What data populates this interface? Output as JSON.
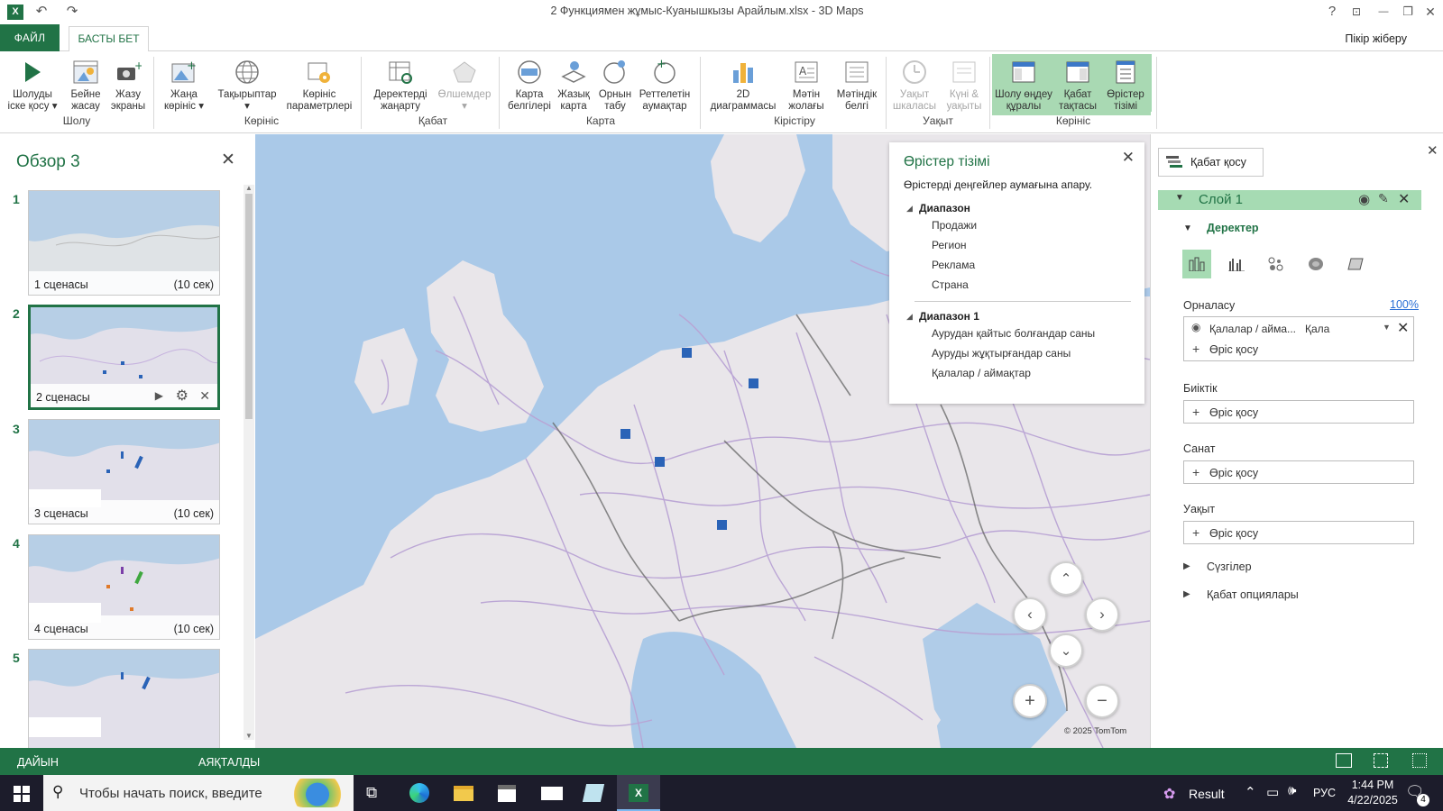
{
  "window": {
    "title": "2 Функциямен жұмыс-Куанышкызы Арайлым.xlsx - 3D Maps",
    "help": "?",
    "restore_icon": "restore-icon",
    "minimize": "—",
    "maximize": "❐",
    "close": "✕"
  },
  "tabs": {
    "file": "ФАЙЛ",
    "home": "БАСТЫ БЕТ",
    "feedback": "Пікір жіберу"
  },
  "ribbon": {
    "buttons": [
      {
        "label1": "Шолуды",
        "label2": "іске қосу ▾"
      },
      {
        "label1": "Бейне",
        "label2": "жасау"
      },
      {
        "label1": "Жазу",
        "label2": "экраны"
      },
      {
        "label1": "Жаңа",
        "label2": "көрініс ▾"
      },
      {
        "label1": "Тақырыптар",
        "label2": "▾"
      },
      {
        "label1": "Көрініс",
        "label2": "параметрлері"
      },
      {
        "label1": "Деректерді",
        "label2": "жаңарту"
      },
      {
        "label1": "Өлшемдер",
        "label2": "▾"
      },
      {
        "label1": "Карта",
        "label2": "белгілері"
      },
      {
        "label1": "Жазық",
        "label2": "карта"
      },
      {
        "label1": "Орнын",
        "label2": "табу"
      },
      {
        "label1": "Реттелетін",
        "label2": "аумақтар"
      },
      {
        "label1": "2D",
        "label2": "диаграммасы"
      },
      {
        "label1": "Мәтін",
        "label2": "жолағы"
      },
      {
        "label1": "Мәтіндік",
        "label2": "белгі"
      },
      {
        "label1": "Уақыт",
        "label2": "шкаласы"
      },
      {
        "label1": "Күні &",
        "label2": "уақыты"
      },
      {
        "label1": "Шолу өңдеу",
        "label2": "құралы"
      },
      {
        "label1": "Қабат",
        "label2": "тақтасы"
      },
      {
        "label1": "Өрістер",
        "label2": "тізімі"
      }
    ],
    "groups": [
      "Шолу",
      "Көрініс",
      "Қабат",
      "Карта",
      "Кірістіру",
      "Уақыт",
      "Көрініс"
    ]
  },
  "scenes": {
    "title": "Обзор 3",
    "close": "✕",
    "items": [
      {
        "num": "1",
        "caption": "1 сценасы",
        "duration": "(10 сек)"
      },
      {
        "num": "2",
        "caption": "2 сценасы",
        "duration": ""
      },
      {
        "num": "3",
        "caption": "3 сценасы",
        "duration": "(10 сек)"
      },
      {
        "num": "4",
        "caption": "4 сценасы",
        "duration": "(10 сек)"
      },
      {
        "num": "5",
        "caption": "",
        "duration": ""
      }
    ]
  },
  "field_list": {
    "title": "Өрістер тізімі",
    "subtitle": "Өрістерді деңгейлер аумағына апару.",
    "close": "✕",
    "groups": [
      {
        "name": "Диапазон",
        "items": [
          "Продажи",
          "Регион",
          "Реклама",
          "Страна"
        ]
      },
      {
        "name": "Диапазон 1",
        "items": [
          "Аурудан қайтыс болғандар саны",
          "Ауруды жұқтырғандар саны",
          "Қалалар / аймақтар"
        ]
      }
    ]
  },
  "map": {
    "copyright": "© 2025 TomTom"
  },
  "layer_panel": {
    "add_layer": "Қабат қосу",
    "close": "✕",
    "layer_name": "Слой 1",
    "data_header": "Деректер",
    "location_label": "Орналасу",
    "location_percent": "100%",
    "location_field": "Қалалар / айма...",
    "location_type": "Қала",
    "add_field": "Өріс қосу",
    "height_label": "Биіктік",
    "category_label": "Санат",
    "time_label": "Уақыт",
    "filters": "Сүзгілер",
    "layer_options": "Қабат опциялары"
  },
  "status": {
    "left": "ДАЙЫН",
    "middle": "АЯҚТАЛДЫ"
  },
  "taskbar": {
    "search_placeholder": "Чтобы начать поиск, введите",
    "result": "Result",
    "lang": "РУС",
    "time": "1:44 PM",
    "date": "4/22/2025",
    "notif_count": "4"
  },
  "colors": {
    "brand": "#217346",
    "selected_ribbon": "#a6dbb3",
    "data_marker": "#2a63b7",
    "road": "#b9a3d4"
  }
}
